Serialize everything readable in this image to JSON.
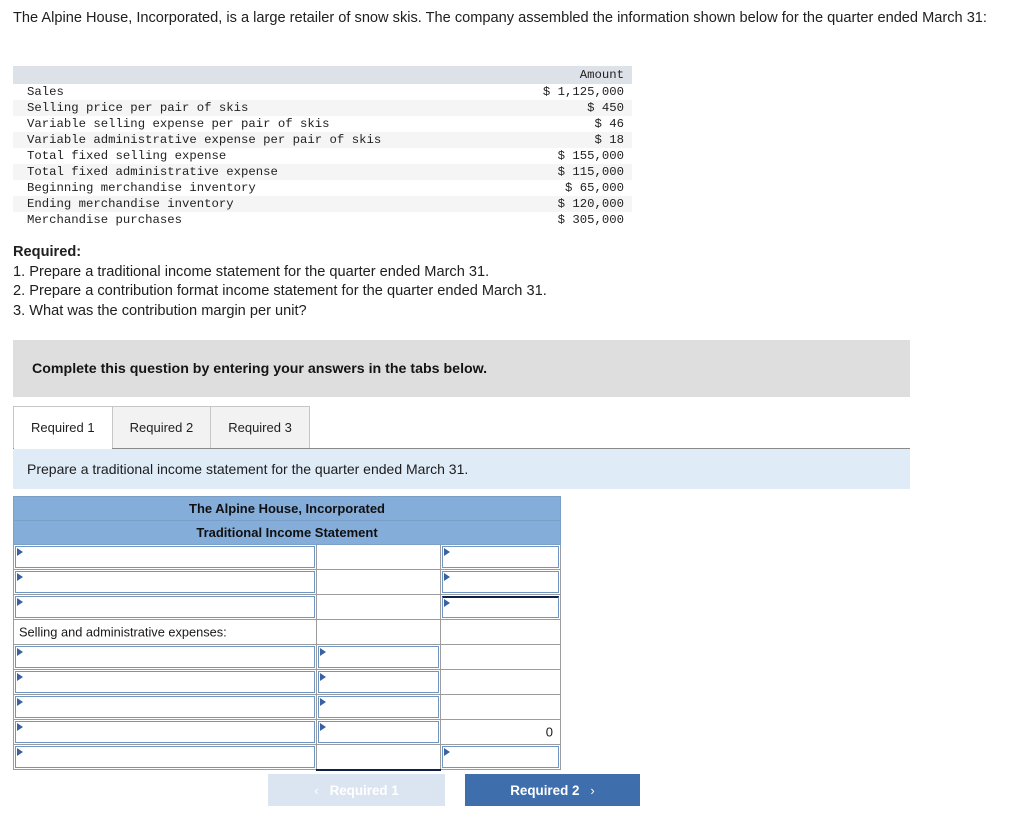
{
  "intro": "The Alpine House, Incorporated, is a large retailer of snow skis. The company assembled the information shown below for the quarter ended March 31:",
  "facts_table": {
    "header_label": "",
    "header_amount": "Amount",
    "rows": [
      {
        "label": "Sales",
        "amount": "$ 1,125,000"
      },
      {
        "label": "Selling price per pair of skis",
        "amount": "$ 450"
      },
      {
        "label": "Variable selling expense per pair of skis",
        "amount": "$ 46"
      },
      {
        "label": "Variable administrative expense per pair of skis",
        "amount": "$ 18"
      },
      {
        "label": "Total fixed selling expense",
        "amount": "$ 155,000"
      },
      {
        "label": "Total fixed administrative expense",
        "amount": "$ 115,000"
      },
      {
        "label": "Beginning merchandise inventory",
        "amount": "$ 65,000"
      },
      {
        "label": "Ending merchandise inventory",
        "amount": "$ 120,000"
      },
      {
        "label": "Merchandise purchases",
        "amount": "$ 305,000"
      }
    ]
  },
  "required": {
    "title": "Required:",
    "items": [
      "1. Prepare a traditional income statement for the quarter ended March 31.",
      "2. Prepare a contribution format income statement for the quarter ended March 31.",
      "3. What was the contribution margin per unit?"
    ]
  },
  "banner": {
    "text": "Complete this question by entering your answers in the tabs below."
  },
  "tabs": [
    {
      "label": "Required 1",
      "active": true
    },
    {
      "label": "Required 2",
      "active": false
    },
    {
      "label": "Required 3",
      "active": false
    }
  ],
  "instruction": {
    "text": "Prepare a traditional income statement for the quarter ended March 31."
  },
  "sheet": {
    "title_line1": "The Alpine House, Incorporated",
    "title_line2": "Traditional Income Statement",
    "rows": [
      {
        "label": "",
        "col2": "",
        "col3": ""
      },
      {
        "label": "",
        "col2": "",
        "col3": ""
      },
      {
        "label": "",
        "col2": "",
        "col3": ""
      },
      {
        "label": "Selling and administrative expenses:",
        "col2": "",
        "col3": ""
      },
      {
        "label": "",
        "col2": "",
        "col3": ""
      },
      {
        "label": "",
        "col2": "",
        "col3": ""
      },
      {
        "label": "",
        "col2": "",
        "col3": ""
      },
      {
        "label": "",
        "col2": "",
        "col3": "0"
      },
      {
        "label": "",
        "col2": "",
        "col3": ""
      }
    ]
  },
  "nav": {
    "prev_label": "Required 1",
    "prev_chevron": "‹",
    "next_label": "Required 2",
    "next_chevron": "›"
  },
  "colors": {
    "sheet_header_blue": "#85add9",
    "banner_grey": "#dedede",
    "instruction_blue": "#dfecf8",
    "next_button_blue": "#3f6ead",
    "prev_button_blue": "#dbe5f1",
    "facts_header": "#dde1e8"
  }
}
